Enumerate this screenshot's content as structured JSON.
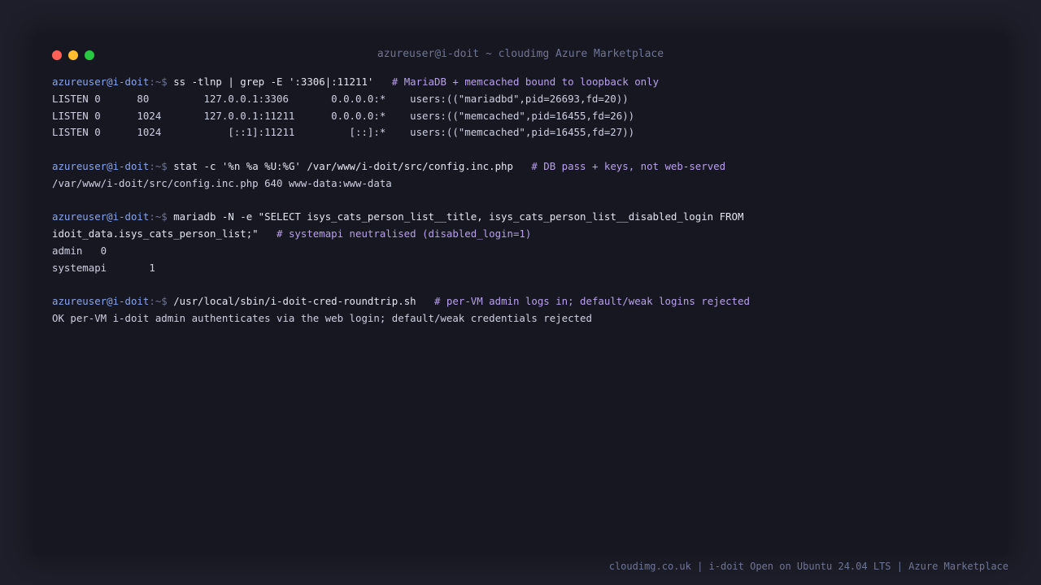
{
  "window": {
    "title": "azureuser@i-doit ~ cloudimg Azure Marketplace",
    "controls": {
      "close_color": "#ff5f57",
      "minimize_color": "#febc2e",
      "zoom_color": "#28c840"
    }
  },
  "prompt": {
    "user_host": "azureuser@i-doit",
    "separator": ":~$"
  },
  "blocks": [
    {
      "command": "ss -tlnp | grep -E ':3306|:11211'",
      "comment": "# MariaDB + memcached bound to loopback only",
      "output": [
        "LISTEN 0      80         127.0.0.1:3306       0.0.0.0:*    users:((\"mariadbd\",pid=26693,fd=20))",
        "LISTEN 0      1024       127.0.0.1:11211      0.0.0.0:*    users:((\"memcached\",pid=16455,fd=26))",
        "LISTEN 0      1024           [::1]:11211         [::]:*    users:((\"memcached\",pid=16455,fd=27))"
      ]
    },
    {
      "command": "stat -c '%n %a %U:%G' /var/www/i-doit/src/config.inc.php",
      "comment": "# DB pass + keys, not web-served",
      "output": [
        "/var/www/i-doit/src/config.inc.php 640 www-data:www-data"
      ]
    },
    {
      "command": "mariadb -N -e \"SELECT isys_cats_person_list__title, isys_cats_person_list__disabled_login FROM",
      "command_cont": "idoit_data.isys_cats_person_list;\"",
      "comment": "# systemapi neutralised (disabled_login=1)",
      "output": [
        "admin   0",
        "systemapi       1"
      ]
    },
    {
      "command": "/usr/local/sbin/i-doit-cred-roundtrip.sh",
      "comment": "# per-VM admin logs in; default/weak logins rejected",
      "output": [
        "OK per-VM i-doit admin authenticates via the web login; default/weak credentials rejected"
      ]
    }
  ],
  "footer": {
    "text": "cloudimg.co.uk | i-doit Open on Ubuntu 24.04 LTS | Azure Marketplace"
  }
}
